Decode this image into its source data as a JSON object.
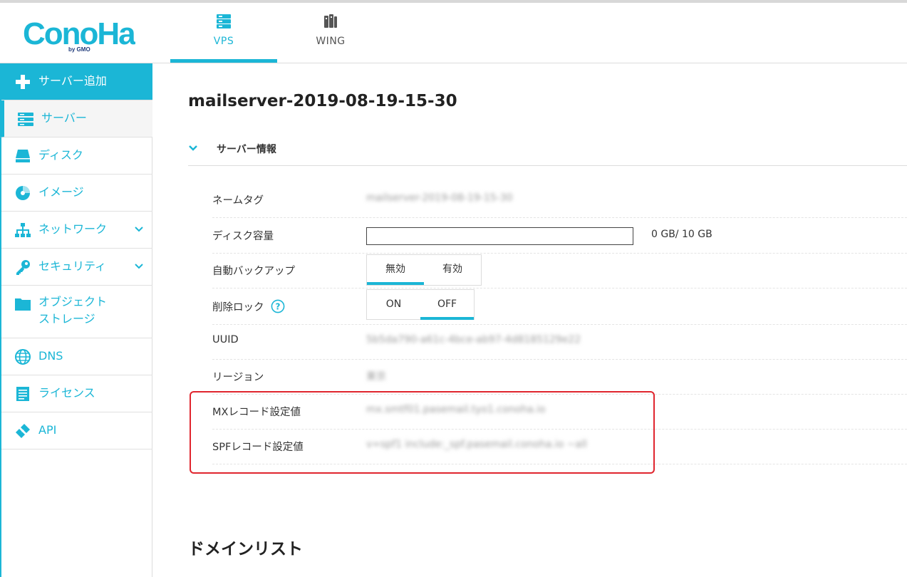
{
  "header": {
    "logo_text": "ConoHa by GMO",
    "tabs": [
      {
        "label": "VPS",
        "icon": "server-stack-icon",
        "active": true
      },
      {
        "label": "WING",
        "icon": "wing-server-icon",
        "active": false
      }
    ],
    "accent_color": "#1bb6d6"
  },
  "sidebar": {
    "items": [
      {
        "label": "サーバー追加",
        "icon": "plus-icon"
      },
      {
        "label": "サーバー",
        "icon": "server-icon"
      },
      {
        "label": "ディスク",
        "icon": "disk-icon"
      },
      {
        "label": "イメージ",
        "icon": "image-disc-icon"
      },
      {
        "label": "ネットワーク",
        "icon": "network-icon"
      },
      {
        "label": "セキュリティ",
        "icon": "key-icon"
      },
      {
        "label": "オブジェクト",
        "label2": "ストレージ",
        "icon": "folder-icon"
      },
      {
        "label": "DNS",
        "icon": "globe-icon"
      },
      {
        "label": "ライセンス",
        "icon": "license-icon"
      },
      {
        "label": "API",
        "icon": "api-plug-icon"
      }
    ]
  },
  "main": {
    "title": "mailserver-2019-08-19-15-30",
    "section": "サーバー情報",
    "rows": {
      "nametag": {
        "label": "ネームタグ",
        "value": "mailserver-2019-08-19-15-30"
      },
      "disk": {
        "label": "ディスク容量",
        "usage": "0 GB/ 10 GB",
        "fill_fraction": 0
      },
      "backup": {
        "label": "自動バックアップ",
        "options": [
          "無効",
          "有効"
        ],
        "selected": "無効"
      },
      "lock": {
        "label": "削除ロック",
        "options": [
          "ON",
          "OFF"
        ],
        "selected": "OFF"
      },
      "uuid": {
        "label": "UUID",
        "value": "5b5da790-a61c-4bce-ab97-4d8185129e22"
      },
      "region": {
        "label": "リージョン",
        "value": "東京"
      },
      "mx": {
        "label": "MXレコード設定値",
        "value": "mx.smtf01.pasemail.tyo1.conoha.io"
      },
      "spf": {
        "label": "SPFレコード設定値",
        "value": "v=spf1 include:_spf.pasemail.conoha.io ~all"
      }
    },
    "domain_list_title": "ドメインリスト"
  },
  "colors": {
    "highlight": "#e0252e",
    "text": "#333333"
  }
}
